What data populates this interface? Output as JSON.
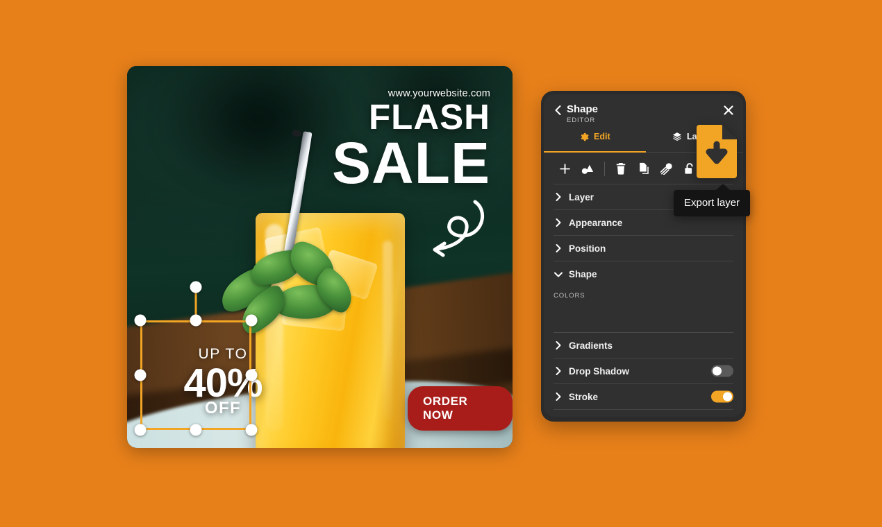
{
  "background_color": "#e8801a",
  "accent_color": "#f2a525",
  "panel_color": "#303030",
  "design": {
    "website": "www.yourwebsite.com",
    "headline_1": "FLASH",
    "headline_2": "SALE",
    "up_to": "UP TO",
    "discount": "40%",
    "off": "OFF",
    "cta": "ORDER NOW",
    "cta_color": "#a81d19"
  },
  "editor": {
    "title": "Shape",
    "subtitle": "EDITOR",
    "back_icon": "chevron-left-icon",
    "close_icon": "close-icon",
    "tabs": [
      {
        "label": "Edit",
        "icon": "gear-icon",
        "active": true
      },
      {
        "label": "La",
        "icon": "layers-icon",
        "active": false
      }
    ],
    "tools": [
      {
        "name": "add-icon",
        "title": "Add"
      },
      {
        "name": "shapes-icon",
        "title": "Shapes"
      },
      {
        "name": "delete-icon",
        "title": "Delete"
      },
      {
        "name": "duplicate-icon",
        "title": "Duplicate"
      },
      {
        "name": "color-picker-icon",
        "title": "Color picker"
      },
      {
        "name": "unlock-icon",
        "title": "Lock"
      }
    ],
    "sections": [
      {
        "label": "Layer",
        "expanded": false,
        "toggle": null
      },
      {
        "label": "Appearance",
        "expanded": false,
        "toggle": null
      },
      {
        "label": "Position",
        "expanded": false,
        "toggle": null
      },
      {
        "label": "Shape",
        "expanded": true,
        "toggle": null
      },
      {
        "label": "Gradients",
        "expanded": false,
        "toggle": null
      },
      {
        "label": "Drop Shadow",
        "expanded": false,
        "toggle": "off"
      },
      {
        "label": "Stroke",
        "expanded": false,
        "toggle": "on"
      }
    ],
    "colors_label": "COLORS"
  },
  "export": {
    "icon": "export-document-download-icon",
    "tooltip": "Export layer"
  }
}
